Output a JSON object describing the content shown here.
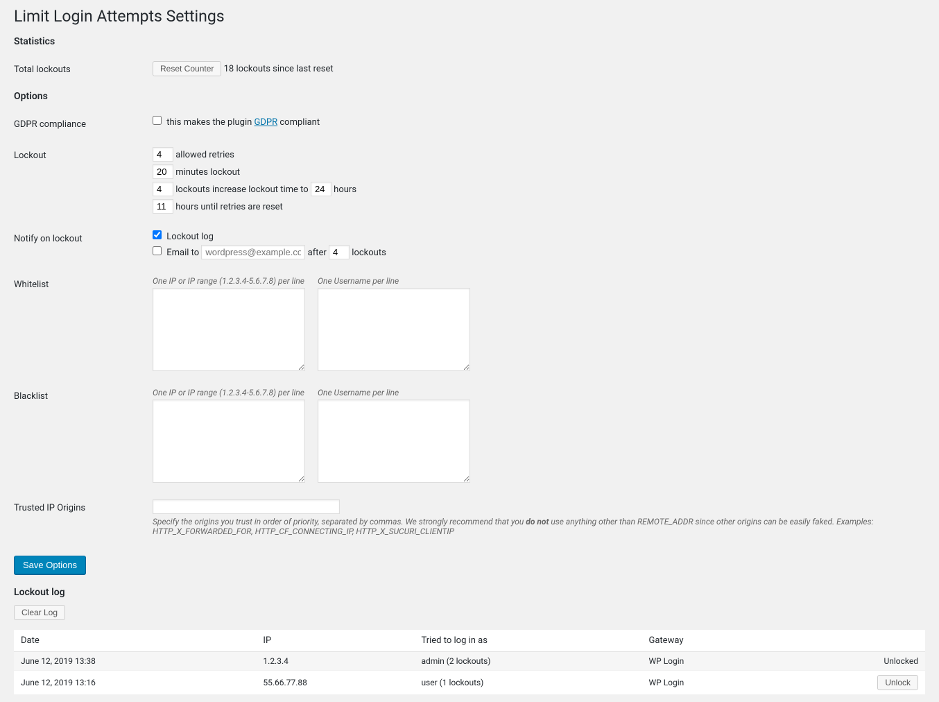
{
  "page": {
    "title": "Limit Login Attempts Settings"
  },
  "sections": {
    "statistics": "Statistics",
    "options": "Options",
    "lockout_log": "Lockout log"
  },
  "labels": {
    "total_lockouts": "Total lockouts",
    "gdpr_compliance": "GDPR compliance",
    "lockout": "Lockout",
    "notify_on_lockout": "Notify on lockout",
    "whitelist": "Whitelist",
    "blacklist": "Blacklist",
    "trusted_ip_origins": "Trusted IP Origins"
  },
  "stats": {
    "reset_button": "Reset Counter",
    "lockouts_text": "18 lockouts since last reset"
  },
  "gdpr": {
    "prefix": "this makes the plugin ",
    "link": "GDPR",
    "suffix": " compliant"
  },
  "lockout": {
    "allowed_retries": "4",
    "allowed_retries_label": "allowed retries",
    "minutes_lockout": "20",
    "minutes_lockout_label": "minutes lockout",
    "lockouts_increase": "4",
    "lockouts_increase_label_before": "lockouts increase lockout time to",
    "lockouts_increase_hours": "24",
    "hours_label": "hours",
    "hours_until_reset": "11",
    "hours_until_reset_label": "hours until retries are reset"
  },
  "notify": {
    "log_label": "Lockout log",
    "email_to_label": "Email to",
    "email_placeholder": "wordpress@example.com",
    "after_label": "after",
    "after_value": "4",
    "lockouts_label": "lockouts"
  },
  "lists": {
    "ip_hint": "One IP or IP range (1.2.3.4-5.6.7.8) per line",
    "user_hint": "One Username per line"
  },
  "trusted": {
    "help_before": "Specify the origins you trust in order of priority, separated by commas. We strongly recommend that you ",
    "help_strong": "do not",
    "help_after": " use anything other than REMOTE_ADDR since other origins can be easily faked. Examples: HTTP_X_FORWARDED_FOR, HTTP_CF_CONNECTING_IP, HTTP_X_SUCURI_CLIENTIP"
  },
  "buttons": {
    "save": "Save Options",
    "clear_log": "Clear Log",
    "unlock": "Unlock"
  },
  "log": {
    "headers": {
      "date": "Date",
      "ip": "IP",
      "tried": "Tried to log in as",
      "gateway": "Gateway"
    },
    "rows": [
      {
        "date": "June 12, 2019 13:38",
        "ip": "1.2.3.4",
        "tried": "admin (2 lockouts)",
        "gateway": "WP Login",
        "status": "Unlocked"
      },
      {
        "date": "June 12, 2019 13:16",
        "ip": "55.66.77.88",
        "tried": "user (1 lockouts)",
        "gateway": "WP Login"
      }
    ]
  }
}
